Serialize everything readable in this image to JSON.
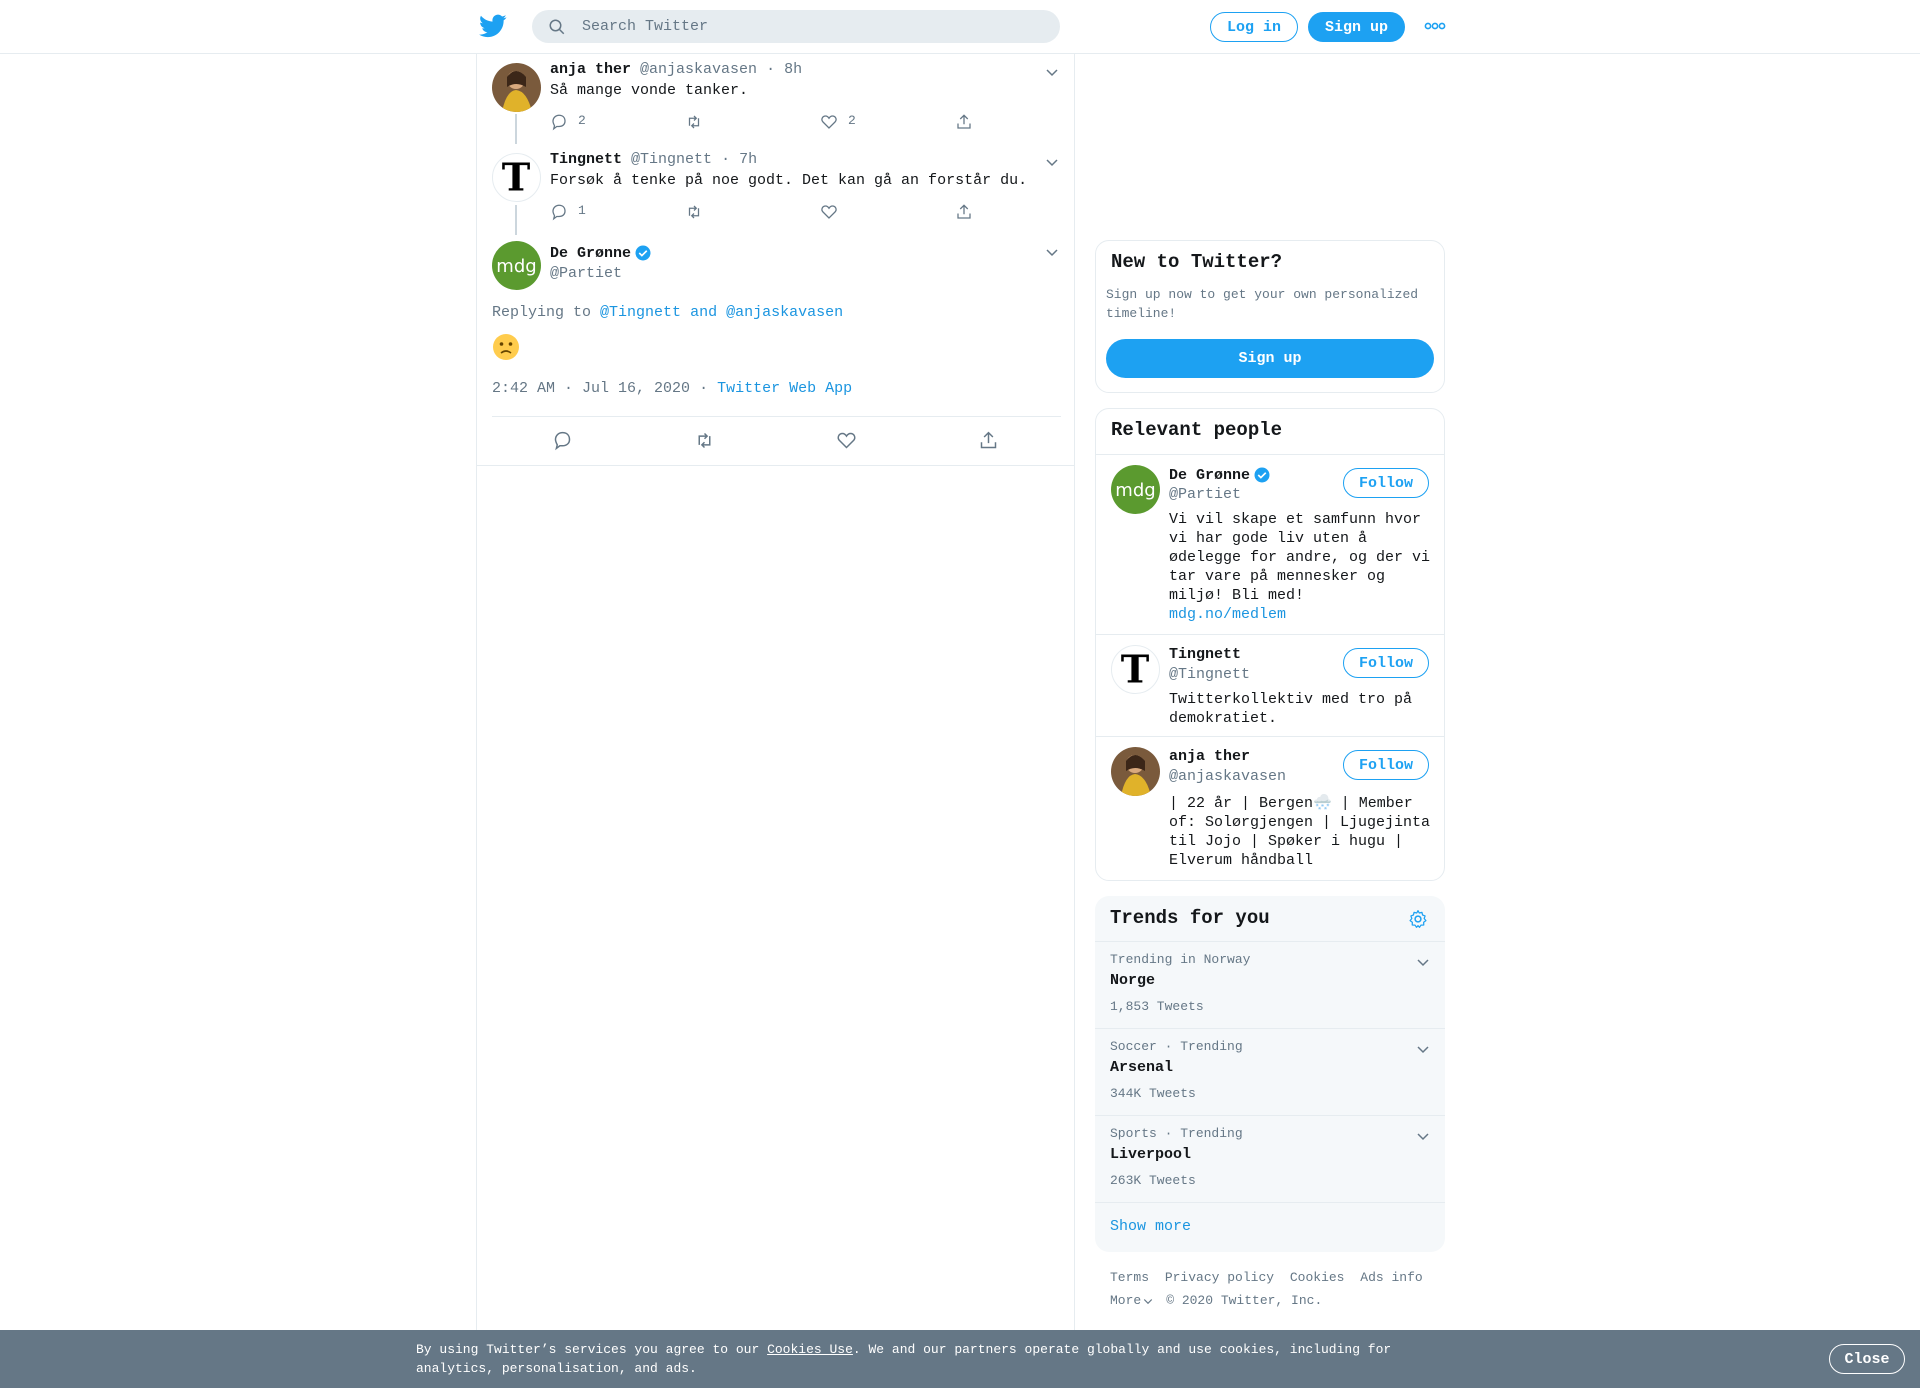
{
  "header": {
    "search_placeholder": "Search Twitter",
    "login_label": "Log in",
    "signup_label": "Sign up",
    "brand_color": "#1da1f2"
  },
  "thread": [
    {
      "name": "anja ther",
      "handle": "@anjaskavasen",
      "time": "· 8h",
      "text": "Så mange vonde tanker.",
      "replies": "2",
      "retweets": "",
      "likes": "2"
    },
    {
      "name": "Tingnett",
      "handle": "@Tingnett",
      "time": "· 7h",
      "text": "Forsøk å tenke på noe godt. Det kan gå an forstår du.",
      "replies": "1",
      "retweets": "",
      "likes": ""
    }
  ],
  "main_tweet": {
    "name": "De Grønne",
    "handle": "@Partiet",
    "replying_prefix": "Replying to",
    "replying_to_1": "@Tingnett",
    "replying_and": "and",
    "replying_to_2": "@anjaskavasen",
    "emoji": "🙁",
    "timestamp": "2:42 AM · Jul 16, 2020",
    "separator": "·",
    "source": "Twitter Web App"
  },
  "new_to_twitter": {
    "title": "New to Twitter?",
    "description": "Sign up now to get your own personalized timeline!",
    "signup_label": "Sign up"
  },
  "relevant_people": {
    "title": "Relevant people",
    "follow_label": "Follow",
    "people": [
      {
        "name": "De Grønne",
        "handle": "@Partiet",
        "bio": "Vi vil skape et samfunn hvor vi har gode liv uten å ødelegge for andre, og der vi tar vare på mennesker og miljø! Bli med!",
        "link": "mdg.no/medlem"
      },
      {
        "name": "Tingnett",
        "handle": "@Tingnett",
        "bio": "Twitterkollektiv med tro på demokratiet."
      },
      {
        "name": "anja ther",
        "handle": "@anjaskavasen",
        "bio": "| 22 år | Bergen🌨️ | Member of: Solørgjengen | Ljugejinta til Jojo | Spøker i hugu | Elverum håndball"
      }
    ]
  },
  "trends": {
    "title": "Trends for you",
    "items": [
      {
        "context": "Trending in Norway",
        "name": "Norge",
        "count": "1,853 Tweets"
      },
      {
        "context": "Soccer · Trending",
        "name": "Arsenal",
        "count": "344K Tweets"
      },
      {
        "context": "Sports · Trending",
        "name": "Liverpool",
        "count": "263K Tweets"
      }
    ],
    "show_more": "Show more"
  },
  "footer": {
    "links": [
      "Terms",
      "Privacy policy",
      "Cookies",
      "Ads info"
    ],
    "more": "More",
    "copyright": "© 2020 Twitter, Inc."
  },
  "cookie_bar": {
    "text_before": "By using Twitter’s services you agree to our",
    "link": "Cookies Use",
    "text_after": ". We and our partners operate globally and use cookies, including for analytics, personalisation, and ads.",
    "close_label": "Close"
  }
}
